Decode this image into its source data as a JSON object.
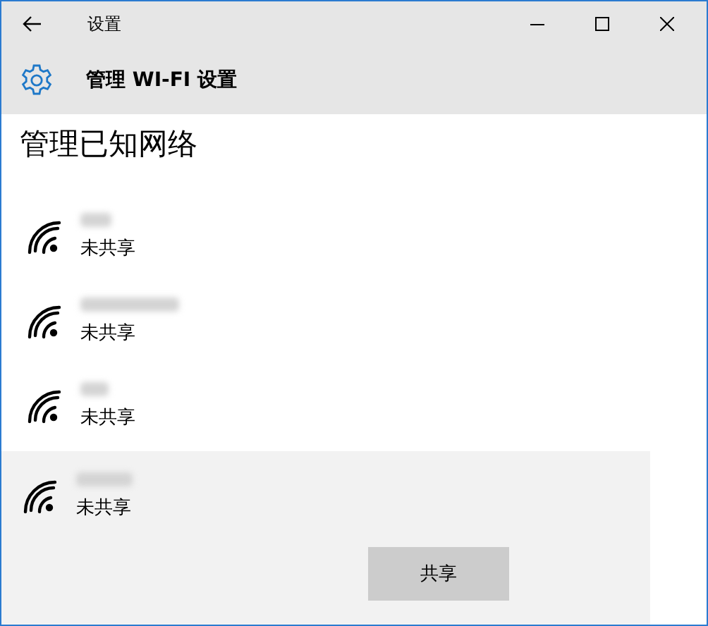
{
  "window": {
    "title": "设置"
  },
  "header": {
    "title": "管理 WI-FI 设置"
  },
  "heading": "管理已知网络",
  "networks": [
    {
      "status": "未共享",
      "selected": false
    },
    {
      "status": "未共享",
      "selected": false
    },
    {
      "status": "未共享",
      "selected": false
    },
    {
      "status": "未共享",
      "selected": true
    }
  ],
  "actions": [
    "共享"
  ]
}
